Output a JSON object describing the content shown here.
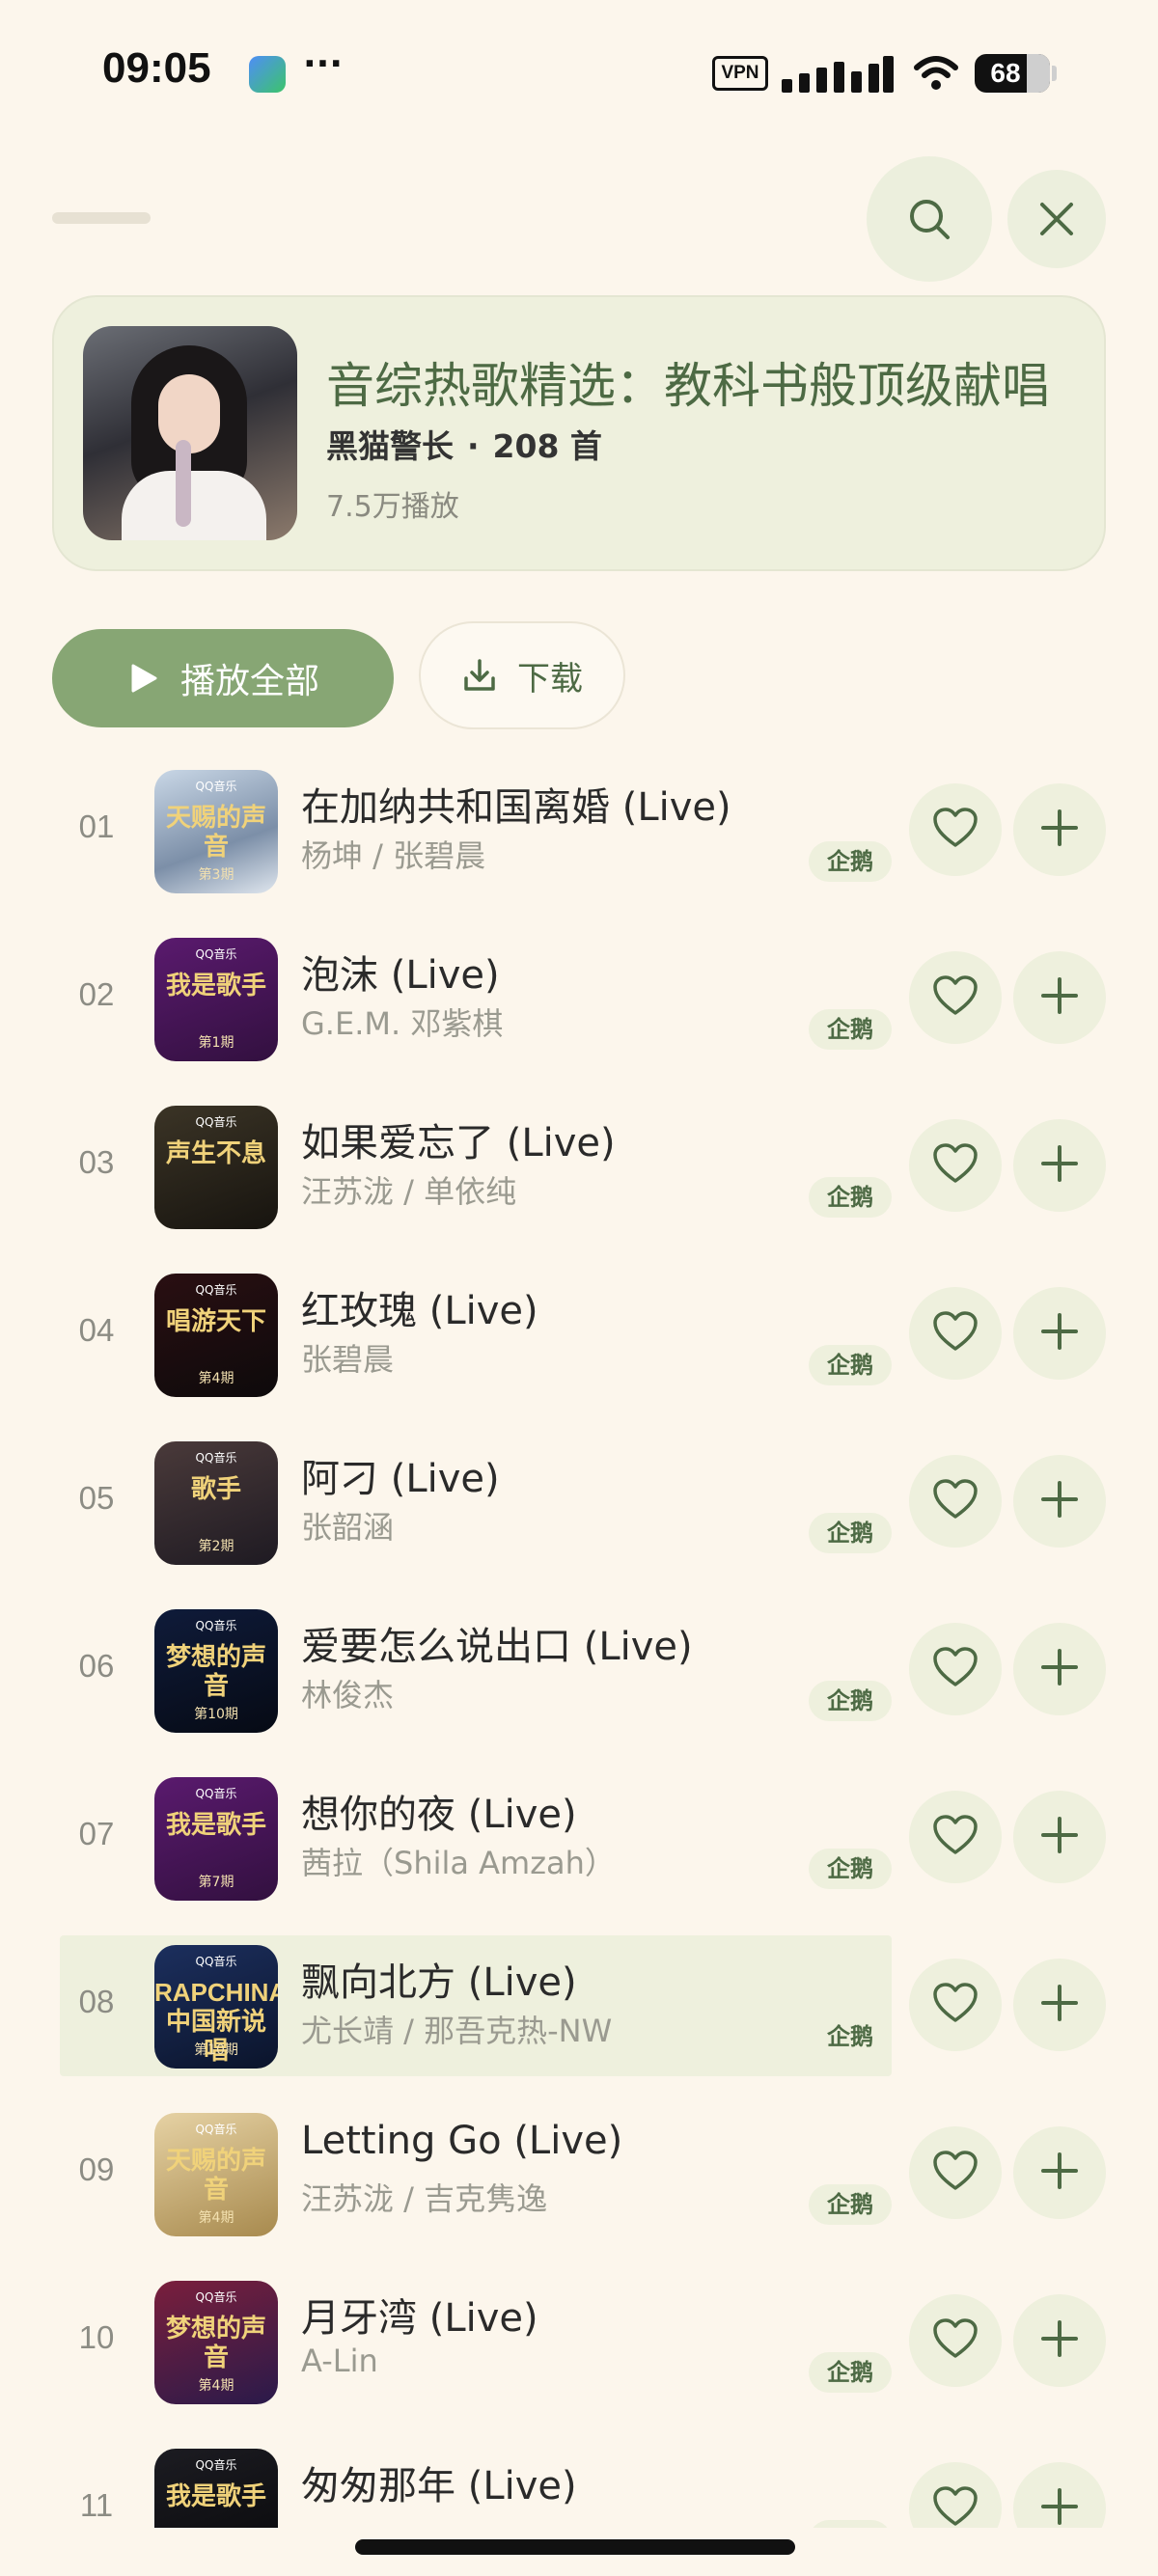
{
  "status_bar": {
    "time": "09:05",
    "dots": "···",
    "vpn": "VPN",
    "battery": "68"
  },
  "playlist": {
    "title": "音综热歌精选：教科书般顶级献唱",
    "creator": "黑猫警长",
    "separator": "·",
    "song_count": "208 首",
    "play_count": "7.5万播放"
  },
  "actions": {
    "play_all": "播放全部",
    "download": "下载"
  },
  "colors": {
    "background": "#fcf6ec",
    "accent": "#87a674",
    "accent_dark": "#4d6a44",
    "pill": "#eef0dd"
  },
  "songs": [
    {
      "index": "01",
      "title": "在加纳共和国离婚 (Live)",
      "artist": "杨坤 / 张碧晨",
      "badge": "企鹅",
      "cover_text": "天赐的声音",
      "cover_sub": "第3期",
      "cover_bg": "linear-gradient(160deg,#c9d7e6,#7c8fa8 60%,#dfe6ee)"
    },
    {
      "index": "02",
      "title": "泡沫 (Live)",
      "artist": "G.E.M. 邓紫棋",
      "badge": "企鹅",
      "cover_text": "我是歌手",
      "cover_sub": "第1期",
      "cover_bg": "linear-gradient(160deg,#5a1a6e,#32103f)"
    },
    {
      "index": "03",
      "title": "如果爱忘了 (Live)",
      "artist": "汪苏泷 / 单依纯",
      "badge": "企鹅",
      "cover_text": "声生不息",
      "cover_sub": "",
      "cover_bg": "linear-gradient(160deg,#3b3426,#17140f)"
    },
    {
      "index": "04",
      "title": "红玫瑰 (Live)",
      "artist": "张碧晨",
      "badge": "企鹅",
      "cover_text": "唱游天下",
      "cover_sub": "第4期",
      "cover_bg": "linear-gradient(160deg,#2a0f12,#0d0a0b)"
    },
    {
      "index": "05",
      "title": "阿刁 (Live)",
      "artist": "张韶涵",
      "badge": "企鹅",
      "cover_text": "歌手",
      "cover_sub": "第2期",
      "cover_bg": "linear-gradient(160deg,#4a3a3a,#1e1a22)"
    },
    {
      "index": "06",
      "title": "爱要怎么说出口 (Live)",
      "artist": "林俊杰",
      "badge": "企鹅",
      "cover_text": "梦想的声音",
      "cover_sub": "第10期",
      "cover_bg": "linear-gradient(160deg,#0f1b3a,#060a14)"
    },
    {
      "index": "07",
      "title": "想你的夜 (Live)",
      "artist": "茜拉（Shila Amzah）",
      "badge": "企鹅",
      "cover_text": "我是歌手",
      "cover_sub": "第7期",
      "cover_bg": "linear-gradient(160deg,#5a1a6e,#32103f)"
    },
    {
      "index": "08",
      "title": "飘向北方 (Live)",
      "artist": "尤长靖 / 那吾克热-NW",
      "badge": "企鹅",
      "cover_text": "RAPCHINA 中国新说唱",
      "cover_sub": "第10期",
      "cover_bg": "linear-gradient(160deg,#1c2f5e,#0b142b)"
    },
    {
      "index": "09",
      "title": "Letting Go (Live)",
      "artist": "汪苏泷 / 吉克隽逸",
      "badge": "企鹅",
      "cover_text": "天赐的声音",
      "cover_sub": "第4期",
      "cover_bg": "linear-gradient(160deg,#e6d2a4,#a88a4e)"
    },
    {
      "index": "10",
      "title": "月牙湾 (Live)",
      "artist": "A-Lin",
      "badge": "企鹅",
      "cover_text": "梦想的声音",
      "cover_sub": "第4期",
      "cover_bg": "linear-gradient(160deg,#7a1f3c,#2a1a4a)"
    },
    {
      "index": "11",
      "title": "匆匆那年 (Live)",
      "artist": "",
      "badge": "企鹅",
      "cover_text": "我是歌手",
      "cover_sub": "",
      "cover_bg": "linear-gradient(160deg,#1c1c22,#08080a)"
    }
  ]
}
